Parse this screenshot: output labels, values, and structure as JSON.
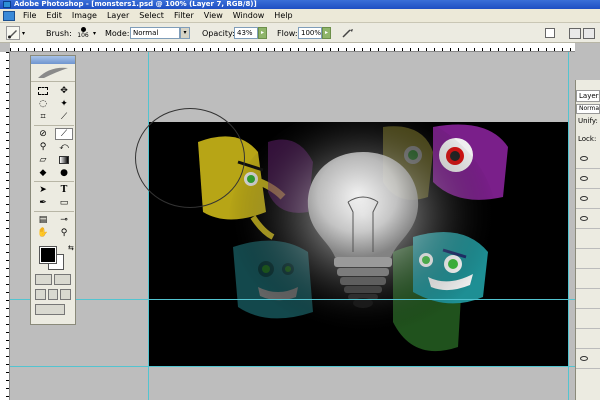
{
  "window": {
    "title": "Adobe Photoshop - [monsters1.psd @ 100% (Layer 7, RGB/8)]"
  },
  "menu": [
    "File",
    "Edit",
    "Image",
    "Layer",
    "Select",
    "Filter",
    "View",
    "Window",
    "Help"
  ],
  "options": {
    "brush_label": "Brush:",
    "brush_size": "106",
    "mode_label": "Mode:",
    "mode_value": "Normal",
    "opacity_label": "Opacity:",
    "opacity_value": "43%",
    "flow_label": "Flow:",
    "flow_value": "100%"
  },
  "layers_panel": {
    "tab": "Layers",
    "blend_mode": "Normal",
    "unify_label": "Unify:",
    "lock_label": "Lock:"
  },
  "icons": [
    "photoshop-logo-icon",
    "brush-tool-icon",
    "airbrush-icon",
    "eye-icon"
  ],
  "colors": {
    "guide": "#53c4d0",
    "canvas": "#000000",
    "titlebar": "#1e4fc2",
    "foreground": "#000000",
    "background": "#ffffff"
  }
}
